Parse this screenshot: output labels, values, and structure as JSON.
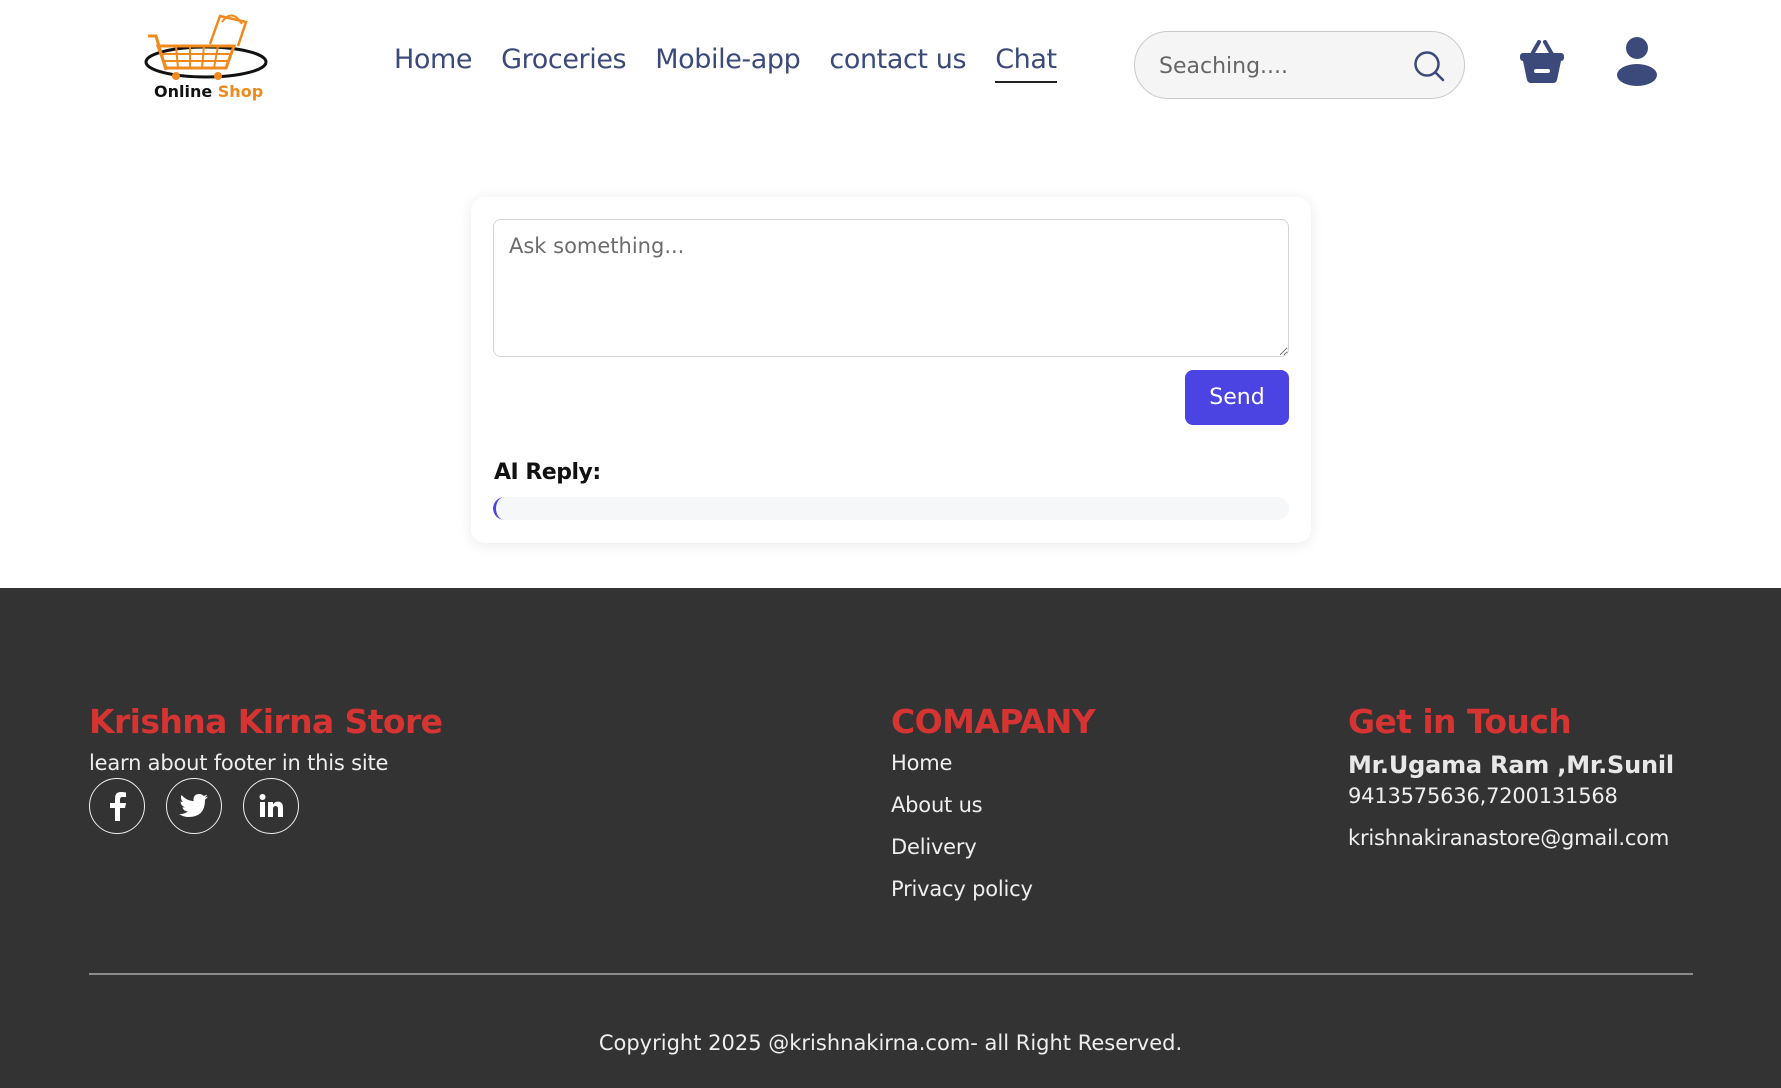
{
  "brand": {
    "logo_text_a": "Online",
    "logo_text_b": "Shop"
  },
  "nav": {
    "items": [
      {
        "label": "Home",
        "active": false
      },
      {
        "label": "Groceries",
        "active": false
      },
      {
        "label": "Mobile-app",
        "active": false
      },
      {
        "label": "contact us",
        "active": false
      },
      {
        "label": "Chat",
        "active": true
      }
    ]
  },
  "search": {
    "placeholder": "Seaching...."
  },
  "icons": {
    "search": "search-icon",
    "cart": "basket-icon",
    "user": "user-icon"
  },
  "chat": {
    "input_placeholder": "Ask something...",
    "send_label": "Send",
    "reply_label": "AI Reply:",
    "reply_text": ""
  },
  "footer": {
    "store_title": "Krishna Kirna Store",
    "store_text": "learn about footer in this site",
    "social": [
      "facebook-icon",
      "twitter-icon",
      "linkedin-icon"
    ],
    "company_title": "COMAPANY",
    "company_links": [
      "Home",
      "About us",
      "Delivery",
      "Privacy policy"
    ],
    "contact_title": "Get in Touch",
    "contact_names": "Mr.Ugama Ram ,Mr.Sunil",
    "contact_phones": "9413575636,7200131568",
    "contact_email": "krishnakiranastore@gmail.com",
    "copyright": "Copyright 2025 @krishnakirna.com- all Right Reserved."
  },
  "colors": {
    "nav_text": "#3b4a7a",
    "accent": "#4b44e2",
    "footer_bg": "#333333",
    "footer_title": "#d63333",
    "logo_orange": "#f08a1c"
  }
}
